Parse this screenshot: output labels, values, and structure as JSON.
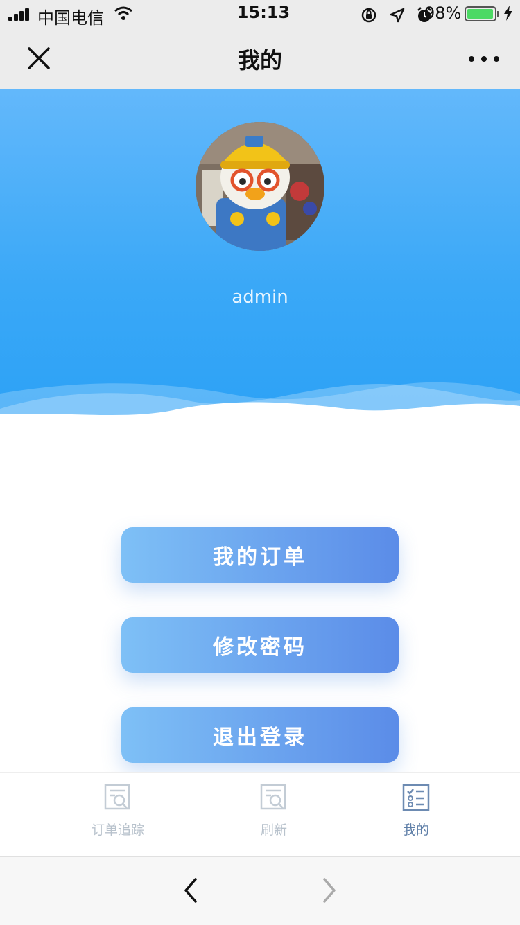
{
  "status_bar": {
    "carrier": "中国电信",
    "time": "15:13",
    "battery_percent": "98%",
    "battery_level": 0.98,
    "icons": [
      "signal-icon",
      "wifi-icon",
      "rotation-lock-icon",
      "location-icon",
      "alarm-icon",
      "battery-icon",
      "charging-icon"
    ]
  },
  "nav": {
    "title": "我的",
    "close_icon": "close-icon",
    "more_icon": "more-icon"
  },
  "header": {
    "username": "admin",
    "colors": {
      "top": "#63b8fb",
      "bottom": "#29a0f6"
    }
  },
  "actions": {
    "my_orders": "我的订单",
    "change_password": "修改密码",
    "logout": "退出登录",
    "gradient": [
      "#7ec0f6",
      "#5b8ce8"
    ]
  },
  "tabs": [
    {
      "label": "订单追踪",
      "icon": "order-search-icon",
      "active": false
    },
    {
      "label": "刷新",
      "icon": "refresh-search-icon",
      "active": false
    },
    {
      "label": "我的",
      "icon": "checklist-icon",
      "active": true
    }
  ],
  "browser": {
    "back_icon": "chevron-left-icon",
    "forward_icon": "chevron-right-icon"
  }
}
